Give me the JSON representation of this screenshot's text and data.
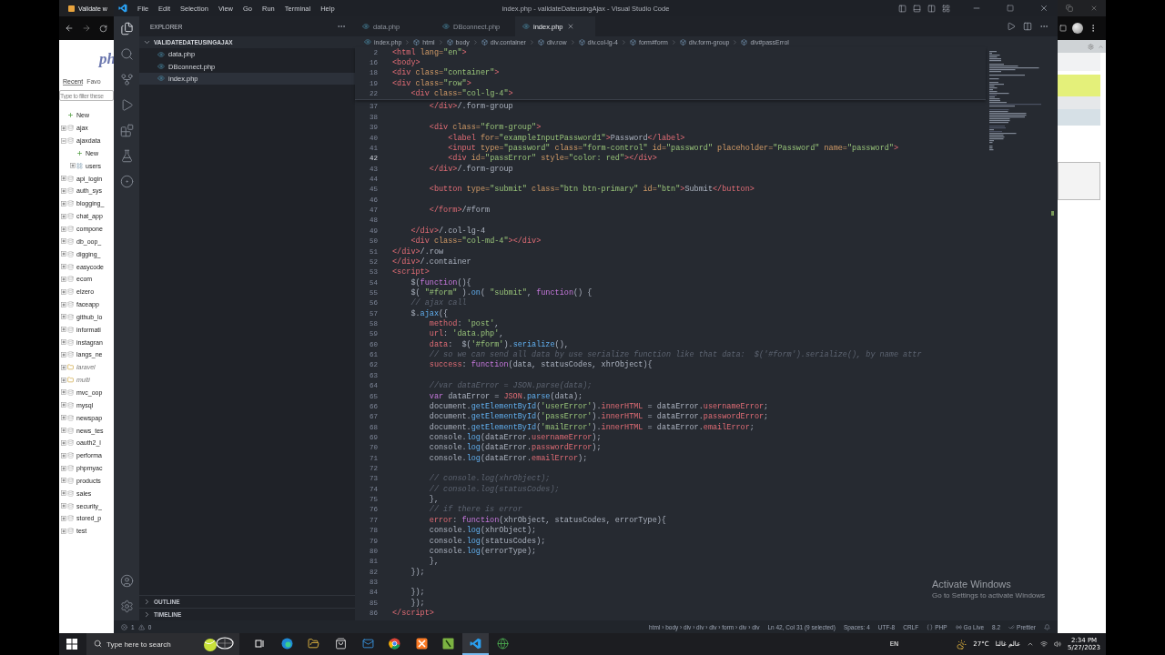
{
  "browser_left": {
    "tab_title": "Validate w",
    "logo": "ph",
    "nav_tabs": [
      {
        "label": "Recent",
        "selected": true
      },
      {
        "label": "Favo",
        "selected": false
      }
    ],
    "filter": {
      "placeholder": "Type to filter these"
    },
    "db_tree": [
      {
        "label": "New",
        "kind": "new"
      },
      {
        "label": "ajax",
        "kind": "db",
        "expanded": false
      },
      {
        "label": "ajaxdata",
        "kind": "db",
        "expanded": true,
        "children": [
          {
            "label": "New",
            "kind": "new"
          },
          {
            "label": "users",
            "kind": "table",
            "expanded": false
          }
        ]
      },
      {
        "label": "api_login",
        "kind": "db",
        "expanded": false
      },
      {
        "label": "auth_sys",
        "kind": "db",
        "expanded": false
      },
      {
        "label": "blogging_",
        "kind": "db",
        "expanded": false
      },
      {
        "label": "chat_app",
        "kind": "db",
        "expanded": false
      },
      {
        "label": "compone",
        "kind": "db",
        "expanded": false
      },
      {
        "label": "db_oop_",
        "kind": "db",
        "expanded": false
      },
      {
        "label": "digging_",
        "kind": "db",
        "expanded": false
      },
      {
        "label": "easycode",
        "kind": "db",
        "expanded": false
      },
      {
        "label": "ecom",
        "kind": "db",
        "expanded": false
      },
      {
        "label": "elzero",
        "kind": "db",
        "expanded": false
      },
      {
        "label": "faceapp",
        "kind": "db",
        "expanded": false
      },
      {
        "label": "github_lo",
        "kind": "db",
        "expanded": false
      },
      {
        "label": "informati",
        "kind": "db",
        "expanded": false
      },
      {
        "label": "instagran",
        "kind": "db",
        "expanded": false
      },
      {
        "label": "langs_ne",
        "kind": "db",
        "expanded": false
      },
      {
        "label": "laravel",
        "kind": "group",
        "expanded": false
      },
      {
        "label": "multi",
        "kind": "group",
        "expanded": false
      },
      {
        "label": "mvc_oop",
        "kind": "db",
        "expanded": false
      },
      {
        "label": "mysql",
        "kind": "db",
        "expanded": false
      },
      {
        "label": "newspap",
        "kind": "db",
        "expanded": false
      },
      {
        "label": "news_tes",
        "kind": "db",
        "expanded": false
      },
      {
        "label": "oauth2_l",
        "kind": "db",
        "expanded": false
      },
      {
        "label": "performa",
        "kind": "db",
        "expanded": false
      },
      {
        "label": "phpmyac",
        "kind": "db",
        "expanded": false
      },
      {
        "label": "products",
        "kind": "db",
        "expanded": false
      },
      {
        "label": "sales",
        "kind": "db",
        "expanded": false
      },
      {
        "label": "security_",
        "kind": "db",
        "expanded": false
      },
      {
        "label": "stored_p",
        "kind": "db",
        "expanded": false
      },
      {
        "label": "test",
        "kind": "db",
        "expanded": false
      }
    ]
  },
  "window": {
    "title": "index.php - validateDateusingAjax - Visual Studio Code",
    "menu": [
      "File",
      "Edit",
      "Selection",
      "View",
      "Go",
      "Run",
      "Terminal",
      "Help"
    ]
  },
  "explorer": {
    "title": "EXPLORER",
    "folder": {
      "label": "VALIDATEDATEUSINGAJAX",
      "expanded": true
    },
    "files": [
      {
        "label": "data.php",
        "selected": false
      },
      {
        "label": "DBconnect.php",
        "selected": false
      },
      {
        "label": "index.php",
        "selected": true
      }
    ],
    "sections": [
      {
        "label": "OUTLINE",
        "expanded": false
      },
      {
        "label": "TIMELINE",
        "expanded": false
      }
    ]
  },
  "tabs": [
    {
      "label": "data.php",
      "selected": false
    },
    {
      "label": "DBconnect.php",
      "selected": false
    },
    {
      "label": "index.php",
      "selected": true
    }
  ],
  "breadcrumbs": [
    "index.php",
    "html",
    "body",
    "div.container",
    "div.row",
    "div.col-lg-4",
    "form#form",
    "div.form-group",
    "div#passErrol"
  ],
  "sticky_lines": [
    {
      "number": "2",
      "current": false,
      "tokens": [
        {
          "kind": "tag",
          "text": "<html"
        },
        {
          "kind": "attr",
          "text": " lang="
        },
        {
          "kind": "str",
          "text": "\"en\""
        },
        {
          "kind": "tag",
          "text": ">"
        }
      ]
    },
    {
      "number": "16",
      "current": false,
      "tokens": [
        {
          "kind": "tag",
          "text": "<body>"
        }
      ]
    },
    {
      "number": "18",
      "current": false,
      "tokens": [
        {
          "kind": "tag",
          "text": "<div"
        },
        {
          "kind": "attr",
          "text": " class="
        },
        {
          "kind": "str",
          "text": "\"container\""
        },
        {
          "kind": "tag",
          "text": ">"
        }
      ]
    },
    {
      "number": "19",
      "current": false,
      "tokens": [
        {
          "kind": "tag",
          "text": "<div"
        },
        {
          "kind": "attr",
          "text": " class="
        },
        {
          "kind": "str",
          "text": "\"row\""
        },
        {
          "kind": "tag",
          "text": ">"
        }
      ]
    },
    {
      "number": "22",
      "current": false,
      "tokens": [
        {
          "kind": "tag",
          "text": "    <div"
        },
        {
          "kind": "attr",
          "text": " class="
        },
        {
          "kind": "str",
          "text": "\"col-lg-4\""
        },
        {
          "kind": "tag",
          "text": ">"
        }
      ]
    }
  ],
  "lines": [
    {
      "number": "37",
      "current": false,
      "tokens": [
        {
          "kind": "tag",
          "text": "        </div>"
        },
        {
          "kind": "txt",
          "text": "/.form-group"
        }
      ]
    },
    {
      "number": "38",
      "current": false
    },
    {
      "number": "39",
      "current": false,
      "tokens": [
        {
          "kind": "tag",
          "text": "        <div"
        },
        {
          "kind": "attr",
          "text": " class="
        },
        {
          "kind": "str",
          "text": "\"form-group\""
        },
        {
          "kind": "tag",
          "text": ">"
        }
      ]
    },
    {
      "number": "40",
      "current": false,
      "tokens": [
        {
          "kind": "tag",
          "text": "            <label"
        },
        {
          "kind": "attr",
          "text": " for="
        },
        {
          "kind": "str",
          "text": "\"exampleInputPassword1\""
        },
        {
          "kind": "tag",
          "text": ">"
        },
        {
          "kind": "txt",
          "text": "Password"
        },
        {
          "kind": "tag",
          "text": "</label>"
        }
      ]
    },
    {
      "number": "41",
      "current": false,
      "tokens": [
        {
          "kind": "tag",
          "text": "            <input"
        },
        {
          "kind": "attr",
          "text": " type="
        },
        {
          "kind": "str",
          "text": "\"password\""
        },
        {
          "kind": "attr",
          "text": " class="
        },
        {
          "kind": "str",
          "text": "\"form-control\""
        },
        {
          "kind": "attr",
          "text": " id="
        },
        {
          "kind": "str",
          "text": "\"password\""
        },
        {
          "kind": "attr",
          "text": " placeholder="
        },
        {
          "kind": "str",
          "text": "\"Password\""
        },
        {
          "kind": "attr",
          "text": " name="
        },
        {
          "kind": "str",
          "text": "\"password\""
        },
        {
          "kind": "tag",
          "text": ">"
        }
      ]
    },
    {
      "number": "42",
      "current": true,
      "tokens": [
        {
          "kind": "tag",
          "text": "            <div"
        },
        {
          "kind": "attr",
          "text": " id="
        },
        {
          "kind": "str",
          "text": "\"passError\""
        },
        {
          "kind": "attr",
          "text": " style="
        },
        {
          "kind": "str",
          "text": "\"color: red\""
        },
        {
          "kind": "tag",
          "text": "></div>"
        }
      ]
    },
    {
      "number": "43",
      "current": false,
      "tokens": [
        {
          "kind": "tag",
          "text": "        </div>"
        },
        {
          "kind": "txt",
          "text": "/.form-group"
        }
      ]
    },
    {
      "number": "44",
      "current": false
    },
    {
      "number": "45",
      "current": false,
      "tokens": [
        {
          "kind": "tag",
          "text": "        <button"
        },
        {
          "kind": "attr",
          "text": " type="
        },
        {
          "kind": "str",
          "text": "\"submit\""
        },
        {
          "kind": "attr",
          "text": " class="
        },
        {
          "kind": "str",
          "text": "\"btn btn-primary\""
        },
        {
          "kind": "attr",
          "text": " id="
        },
        {
          "kind": "str",
          "text": "\"btn\""
        },
        {
          "kind": "tag",
          "text": ">"
        },
        {
          "kind": "txt",
          "text": "Submit"
        },
        {
          "kind": "tag",
          "text": "</button>"
        }
      ]
    },
    {
      "number": "46",
      "current": false
    },
    {
      "number": "47",
      "current": false,
      "tokens": [
        {
          "kind": "tag",
          "text": "        </form>"
        },
        {
          "kind": "txt",
          "text": "/#form"
        }
      ]
    },
    {
      "number": "48",
      "current": false
    },
    {
      "number": "49",
      "current": false,
      "tokens": [
        {
          "kind": "tag",
          "text": "    </div>"
        },
        {
          "kind": "txt",
          "text": "/.col-lg-4"
        }
      ]
    },
    {
      "number": "50",
      "current": false,
      "tokens": [
        {
          "kind": "tag",
          "text": "    <div"
        },
        {
          "kind": "attr",
          "text": " class="
        },
        {
          "kind": "str",
          "text": "\"col-md-4\""
        },
        {
          "kind": "tag",
          "text": "></div>"
        }
      ]
    },
    {
      "number": "51",
      "current": false,
      "tokens": [
        {
          "kind": "tag",
          "text": "</div>"
        },
        {
          "kind": "txt",
          "text": "/.row"
        }
      ]
    },
    {
      "number": "52",
      "current": false,
      "tokens": [
        {
          "kind": "tag",
          "text": "</div>"
        },
        {
          "kind": "txt",
          "text": "/.container"
        }
      ]
    },
    {
      "number": "53",
      "current": false,
      "tokens": [
        {
          "kind": "tag",
          "text": "<script>"
        }
      ]
    },
    {
      "number": "54",
      "current": false,
      "tokens": [
        {
          "kind": "txt",
          "text": "    $("
        },
        {
          "kind": "kw",
          "text": "function"
        },
        {
          "kind": "txt",
          "text": "(){"
        }
      ]
    },
    {
      "number": "55",
      "current": false,
      "tokens": [
        {
          "kind": "txt",
          "text": "    $( "
        },
        {
          "kind": "str",
          "text": "\"#form\""
        },
        {
          "kind": "txt",
          "text": " )."
        },
        {
          "kind": "fn",
          "text": "on"
        },
        {
          "kind": "txt",
          "text": "( "
        },
        {
          "kind": "str",
          "text": "\"submit\""
        },
        {
          "kind": "txt",
          "text": ", "
        },
        {
          "kind": "kw",
          "text": "function"
        },
        {
          "kind": "txt",
          "text": "() {"
        }
      ]
    },
    {
      "number": "56",
      "current": false,
      "tokens": [
        {
          "kind": "cmt",
          "text": "    // ajax call"
        }
      ]
    },
    {
      "number": "57",
      "current": false,
      "tokens": [
        {
          "kind": "txt",
          "text": "    $."
        },
        {
          "kind": "fn",
          "text": "ajax"
        },
        {
          "kind": "txt",
          "text": "({"
        }
      ]
    },
    {
      "number": "58",
      "current": false,
      "tokens": [
        {
          "kind": "prop",
          "text": "        method"
        },
        {
          "kind": "txt",
          "text": ": "
        },
        {
          "kind": "str",
          "text": "'post'"
        },
        {
          "kind": "txt",
          "text": ","
        }
      ]
    },
    {
      "number": "59",
      "current": false,
      "tokens": [
        {
          "kind": "prop",
          "text": "        url"
        },
        {
          "kind": "txt",
          "text": ": "
        },
        {
          "kind": "str",
          "text": "'data.php'"
        },
        {
          "kind": "txt",
          "text": ","
        }
      ]
    },
    {
      "number": "60",
      "current": false,
      "tokens": [
        {
          "kind": "prop",
          "text": "        data"
        },
        {
          "kind": "txt",
          "text": ":  $("
        },
        {
          "kind": "str",
          "text": "'#form'"
        },
        {
          "kind": "txt",
          "text": ")."
        },
        {
          "kind": "fn",
          "text": "serialize"
        },
        {
          "kind": "txt",
          "text": "(),"
        }
      ]
    },
    {
      "number": "61",
      "current": false,
      "tokens": [
        {
          "kind": "cmt",
          "text": "        // so we can send all data by use serialize function like that data:  $('#form').serialize(), by name attr"
        }
      ]
    },
    {
      "number": "62",
      "current": false,
      "tokens": [
        {
          "kind": "prop",
          "text": "        success"
        },
        {
          "kind": "txt",
          "text": ": "
        },
        {
          "kind": "kw",
          "text": "function"
        },
        {
          "kind": "txt",
          "text": "(data, statusCodes, xhrObject){"
        }
      ]
    },
    {
      "number": "63",
      "current": false
    },
    {
      "number": "64",
      "current": false,
      "tokens": [
        {
          "kind": "cmt",
          "text": "        //var dataError = JSON.parse(data);"
        }
      ]
    },
    {
      "number": "65",
      "current": false,
      "tokens": [
        {
          "kind": "kw",
          "text": "        var"
        },
        {
          "kind": "txt",
          "text": " dataError = "
        },
        {
          "kind": "prop",
          "text": "JSON"
        },
        {
          "kind": "txt",
          "text": "."
        },
        {
          "kind": "fn",
          "text": "parse"
        },
        {
          "kind": "txt",
          "text": "(data);"
        }
      ]
    },
    {
      "number": "66",
      "current": false,
      "tokens": [
        {
          "kind": "txt",
          "text": "        document."
        },
        {
          "kind": "fn",
          "text": "getElementById"
        },
        {
          "kind": "txt",
          "text": "("
        },
        {
          "kind": "str",
          "text": "'userError'"
        },
        {
          "kind": "txt",
          "text": ")."
        },
        {
          "kind": "prop",
          "text": "innerHTML"
        },
        {
          "kind": "txt",
          "text": " = dataError."
        },
        {
          "kind": "prop",
          "text": "usernameError"
        },
        {
          "kind": "txt",
          "text": ";"
        }
      ]
    },
    {
      "number": "67",
      "current": false,
      "tokens": [
        {
          "kind": "txt",
          "text": "        document."
        },
        {
          "kind": "fn",
          "text": "getElementById"
        },
        {
          "kind": "txt",
          "text": "("
        },
        {
          "kind": "str",
          "text": "'passError'"
        },
        {
          "kind": "txt",
          "text": ")."
        },
        {
          "kind": "prop",
          "text": "innerHTML"
        },
        {
          "kind": "txt",
          "text": " = dataError."
        },
        {
          "kind": "prop",
          "text": "passwordError"
        },
        {
          "kind": "txt",
          "text": ";"
        }
      ]
    },
    {
      "number": "68",
      "current": false,
      "tokens": [
        {
          "kind": "txt",
          "text": "        document."
        },
        {
          "kind": "fn",
          "text": "getElementById"
        },
        {
          "kind": "txt",
          "text": "("
        },
        {
          "kind": "str",
          "text": "'mailError'"
        },
        {
          "kind": "txt",
          "text": ")."
        },
        {
          "kind": "prop",
          "text": "innerHTML"
        },
        {
          "kind": "txt",
          "text": " = dataError."
        },
        {
          "kind": "prop",
          "text": "emailError"
        },
        {
          "kind": "txt",
          "text": ";"
        }
      ]
    },
    {
      "number": "69",
      "current": false,
      "tokens": [
        {
          "kind": "txt",
          "text": "        console."
        },
        {
          "kind": "fn",
          "text": "log"
        },
        {
          "kind": "txt",
          "text": "(dataError."
        },
        {
          "kind": "prop",
          "text": "usernameError"
        },
        {
          "kind": "txt",
          "text": ");"
        }
      ]
    },
    {
      "number": "70",
      "current": false,
      "tokens": [
        {
          "kind": "txt",
          "text": "        console."
        },
        {
          "kind": "fn",
          "text": "log"
        },
        {
          "kind": "txt",
          "text": "(dataError."
        },
        {
          "kind": "prop",
          "text": "passwordError"
        },
        {
          "kind": "txt",
          "text": ");"
        }
      ]
    },
    {
      "number": "71",
      "current": false,
      "tokens": [
        {
          "kind": "txt",
          "text": "        console."
        },
        {
          "kind": "fn",
          "text": "log"
        },
        {
          "kind": "txt",
          "text": "(dataError."
        },
        {
          "kind": "prop",
          "text": "emailError"
        },
        {
          "kind": "txt",
          "text": ");"
        }
      ]
    },
    {
      "number": "72",
      "current": false
    },
    {
      "number": "73",
      "current": false,
      "tokens": [
        {
          "kind": "cmt",
          "text": "        // console.log(xhrObject);"
        }
      ]
    },
    {
      "number": "74",
      "current": false,
      "tokens": [
        {
          "kind": "cmt",
          "text": "        // console.log(statusCodes);"
        }
      ]
    },
    {
      "number": "75",
      "current": false,
      "tokens": [
        {
          "kind": "txt",
          "text": "        },"
        }
      ]
    },
    {
      "number": "76",
      "current": false,
      "tokens": [
        {
          "kind": "cmt",
          "text": "        // if there is error"
        }
      ]
    },
    {
      "number": "77",
      "current": false,
      "tokens": [
        {
          "kind": "prop",
          "text": "        error"
        },
        {
          "kind": "txt",
          "text": ": "
        },
        {
          "kind": "kw",
          "text": "function"
        },
        {
          "kind": "txt",
          "text": "(xhrObject, statusCodes, errorType){"
        }
      ]
    },
    {
      "number": "78",
      "current": false,
      "tokens": [
        {
          "kind": "txt",
          "text": "        console."
        },
        {
          "kind": "fn",
          "text": "log"
        },
        {
          "kind": "txt",
          "text": "(xhrObject);"
        }
      ]
    },
    {
      "number": "79",
      "current": false,
      "tokens": [
        {
          "kind": "txt",
          "text": "        console."
        },
        {
          "kind": "fn",
          "text": "log"
        },
        {
          "kind": "txt",
          "text": "(statusCodes);"
        }
      ]
    },
    {
      "number": "80",
      "current": false,
      "tokens": [
        {
          "kind": "txt",
          "text": "        console."
        },
        {
          "kind": "fn",
          "text": "log"
        },
        {
          "kind": "txt",
          "text": "(errorType);"
        }
      ]
    },
    {
      "number": "81",
      "current": false,
      "tokens": [
        {
          "kind": "txt",
          "text": "        },"
        }
      ]
    },
    {
      "number": "82",
      "current": false,
      "tokens": [
        {
          "kind": "txt",
          "text": "    });"
        }
      ]
    },
    {
      "number": "83",
      "current": false
    },
    {
      "number": "84",
      "current": false,
      "tokens": [
        {
          "kind": "txt",
          "text": "    });"
        }
      ]
    },
    {
      "number": "85",
      "current": false,
      "tokens": [
        {
          "kind": "txt",
          "text": "    });"
        }
      ]
    },
    {
      "number": "86",
      "current": false,
      "tokens": [
        {
          "kind": "tag",
          "text": "</script>"
        }
      ]
    }
  ],
  "status_bar": {
    "errors": "1",
    "warnings": "0",
    "items": [
      {
        "kind": "plain",
        "text": "html › body › div › div › div › form › div › div"
      },
      {
        "kind": "plain",
        "text": "Ln 42, Col 31 (9 selected)"
      },
      {
        "kind": "plain",
        "text": "Spaces: 4"
      },
      {
        "kind": "plain",
        "text": "UTF-8"
      },
      {
        "kind": "plain",
        "text": "CRLF"
      },
      {
        "kind": "language",
        "text": "PHP"
      },
      {
        "kind": "live",
        "text": "Go Live"
      },
      {
        "kind": "plain",
        "text": "8.2"
      },
      {
        "kind": "prettier",
        "text": "Prettier"
      }
    ]
  },
  "activation": {
    "title": "Activate Windows",
    "subtitle": "Go to Settings to activate Windows"
  },
  "taskbar": {
    "search": {
      "placeholder": "Type here to search"
    },
    "apps": [
      {
        "kind": "taskview",
        "selected": false
      },
      {
        "kind": "edge",
        "selected": false
      },
      {
        "kind": "files",
        "selected": false
      },
      {
        "kind": "store",
        "selected": false
      },
      {
        "kind": "mail",
        "selected": false
      },
      {
        "kind": "chrome",
        "selected": false
      },
      {
        "kind": "xampp",
        "selected": false
      },
      {
        "kind": "sheet",
        "selected": false
      },
      {
        "kind": "vscode",
        "selected": true
      },
      {
        "kind": "globe",
        "selected": false
      }
    ],
    "language": "EN",
    "temperature": "27°C",
    "location": "عالم غالنا",
    "time": "2:34 PM",
    "date": "5/27/2023"
  }
}
